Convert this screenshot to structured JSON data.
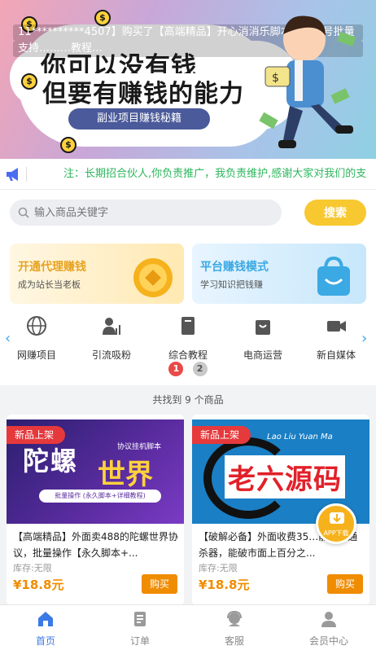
{
  "banner": {
    "ticker_line1": "11**********4507】购买了【高端精品】开心消消乐脚本，可多号批量",
    "ticker_line2": "支持………教程…",
    "slogan_line1": "你可以没有钱",
    "slogan_line2": "但要有赚钱的能力",
    "pill_text": "副业项目赚钱秘籍",
    "coin_symbol": "$"
  },
  "notice": {
    "text": "注：长期招合伙人,你负责推广，我负责维护,感谢大家对我们的支"
  },
  "search": {
    "placeholder": "输入商品关键字",
    "button": "搜索"
  },
  "promos": [
    {
      "title": "开通代理赚钱",
      "subtitle": "成为站长当老板"
    },
    {
      "title": "平台赚钱模式",
      "subtitle": "学习知识把钱赚"
    }
  ],
  "categories": [
    {
      "label": "网赚项目",
      "icon": "globe-icon"
    },
    {
      "label": "引流吸粉",
      "icon": "user-chart-icon"
    },
    {
      "label": "综合教程",
      "icon": "book-icon"
    },
    {
      "label": "电商运营",
      "icon": "shopping-bag-icon"
    },
    {
      "label": "新自媒体",
      "icon": "video-camera-icon"
    }
  ],
  "pagination": {
    "pages": [
      "1",
      "2"
    ],
    "active": "1"
  },
  "result_count": "共找到 9 个商品",
  "products": [
    {
      "badge": "新品上架",
      "thumb_main": "陀螺",
      "thumb_accent": "世界",
      "thumb_sub": "协议挂机脚本",
      "thumb_foot": "批量操作 (永久脚本+详细教程)",
      "title": "【高端精品】外面卖488的陀螺世界协议，批量操作【永久脚本+...",
      "stock": "库存:无限",
      "price": "¥18.8元",
      "buy": "购买"
    },
    {
      "badge": "新品上架",
      "thumb_main": "老六源码",
      "thumb_sub": "Lao Liu Yuan Ma",
      "title": "【破解必备】外面收费35…能脚本通杀器，能破市面上百分之...",
      "stock": "库存:无限",
      "price": "¥18.8元",
      "buy": "购买"
    }
  ],
  "float_button": {
    "label": "APP下载",
    "icon": "download-app-icon"
  },
  "tabbar": [
    {
      "label": "首页",
      "icon": "home-icon",
      "active": true
    },
    {
      "label": "订单",
      "icon": "order-icon",
      "active": false
    },
    {
      "label": "客服",
      "icon": "customer-service-icon",
      "active": false
    },
    {
      "label": "会员中心",
      "icon": "member-icon",
      "active": false
    }
  ],
  "colors": {
    "accent_blue": "#3b7ae6",
    "price_orange": "#f08c00",
    "search_button": "#f7c830",
    "notice_green": "#2cb65c",
    "badge_red": "#e5393c"
  }
}
